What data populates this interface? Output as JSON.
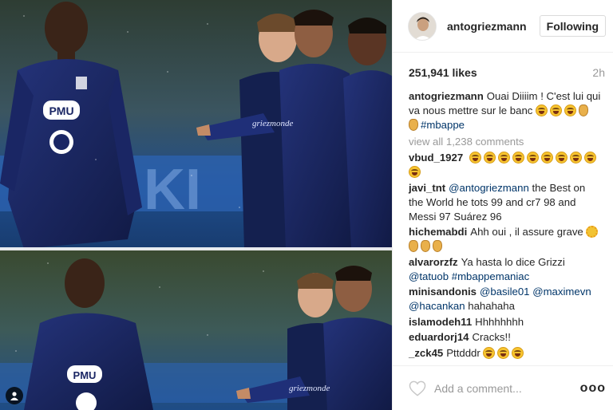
{
  "post": {
    "username": "antogriezmann",
    "follow_label": "Following",
    "likes": "251,941 likes",
    "time": "2h",
    "caption": {
      "user": "antogriezmann",
      "text": "Ouai Diiiim ! C'est lui qui va nous mettre sur le banc",
      "hashtag": "#mbappe"
    },
    "view_all": "view all 1,238 comments",
    "add_comment_placeholder": "Add a comment...",
    "more_label": "ooo",
    "photo": {
      "jersey_text": "griezmonde",
      "sponsor_text": "PMU",
      "banner_text": "KI"
    }
  },
  "comments": [
    {
      "user": "vbud_1927"
    },
    {
      "user": "javi_tnt",
      "mention": "@antogriezmann",
      "text": "the Best on the World he tots 99 and cr7 98 and Messi 97 Suárez 96"
    },
    {
      "user": "hichemabdi",
      "text": "Ahh oui , il assure grave"
    },
    {
      "user": "alvarorzfz",
      "text": "Ya hasta lo dice Grizzi",
      "mention": "@tatuob",
      "hashtag": "#mbappemaniac"
    },
    {
      "user": "minisandonis",
      "mention1": "@basile01",
      "mention2": "@maximevn",
      "mention3": "@hacankan",
      "text": "hahahaha"
    },
    {
      "user": "islamodeh11",
      "text": "Hhhhhhhh"
    },
    {
      "user": "eduardorj14",
      "text": "Cracks!!"
    },
    {
      "user": "_zck45",
      "text": "Pttdddr"
    }
  ],
  "icons": {
    "tag": "person-tag-icon",
    "heart": "heart-icon",
    "more": "more-options-icon"
  },
  "colors": {
    "link": "#003569",
    "muted": "#999999",
    "jersey": "#1b2a6b",
    "border": "#efefef"
  }
}
